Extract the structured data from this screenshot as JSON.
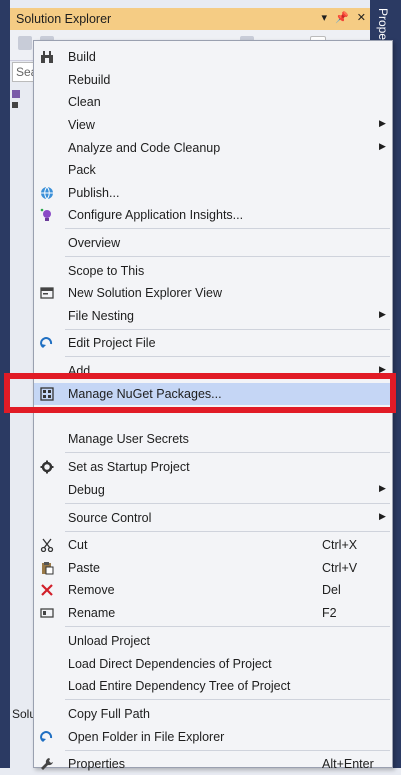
{
  "panel": {
    "title": "Solution Explorer",
    "title_buttons": [
      "▾",
      "📌",
      "✕"
    ],
    "right_tab": "Prope",
    "search_placeholder": "Sea",
    "bottom_tab": "Solu"
  },
  "menu": {
    "items": [
      {
        "label": "Build",
        "icon": "build-icon",
        "shortcut": "",
        "submenu": false
      },
      {
        "label": "Rebuild",
        "icon": "",
        "shortcut": "",
        "submenu": false
      },
      {
        "label": "Clean",
        "icon": "",
        "shortcut": "",
        "submenu": false
      },
      {
        "label": "View",
        "icon": "",
        "shortcut": "",
        "submenu": true
      },
      {
        "label": "Analyze and Code Cleanup",
        "icon": "",
        "shortcut": "",
        "submenu": true
      },
      {
        "label": "Pack",
        "icon": "",
        "shortcut": "",
        "submenu": false
      },
      {
        "label": "Publish...",
        "icon": "globe-icon",
        "shortcut": "",
        "submenu": false
      },
      {
        "label": "Configure Application Insights...",
        "icon": "insights-icon",
        "shortcut": "",
        "submenu": false
      },
      {
        "label": "Overview",
        "icon": "",
        "shortcut": "",
        "submenu": false
      },
      {
        "label": "Scope to This",
        "icon": "",
        "shortcut": "",
        "submenu": false
      },
      {
        "label": "New Solution Explorer View",
        "icon": "new-view-icon",
        "shortcut": "",
        "submenu": false
      },
      {
        "label": "File Nesting",
        "icon": "",
        "shortcut": "",
        "submenu": true
      },
      {
        "label": "Edit Project File",
        "icon": "edit-arrow-icon",
        "shortcut": "",
        "submenu": false
      },
      {
        "label": "Add",
        "icon": "",
        "shortcut": "",
        "submenu": true
      },
      {
        "label": "Manage NuGet Packages...",
        "icon": "nuget-icon",
        "shortcut": "",
        "submenu": false
      },
      {
        "label": "Manage User Secrets",
        "icon": "",
        "shortcut": "",
        "submenu": false
      },
      {
        "label": "Set as Startup Project",
        "icon": "gear-icon",
        "shortcut": "",
        "submenu": false
      },
      {
        "label": "Debug",
        "icon": "",
        "shortcut": "",
        "submenu": true
      },
      {
        "label": "Source Control",
        "icon": "",
        "shortcut": "",
        "submenu": true
      },
      {
        "label": "Cut",
        "icon": "scissors-icon",
        "shortcut": "Ctrl+X",
        "submenu": false
      },
      {
        "label": "Paste",
        "icon": "paste-icon",
        "shortcut": "Ctrl+V",
        "submenu": false
      },
      {
        "label": "Remove",
        "icon": "remove-x-icon",
        "shortcut": "Del",
        "submenu": false
      },
      {
        "label": "Rename",
        "icon": "rename-icon",
        "shortcut": "F2",
        "submenu": false
      },
      {
        "label": "Unload Project",
        "icon": "",
        "shortcut": "",
        "submenu": false
      },
      {
        "label": "Load Direct Dependencies of Project",
        "icon": "",
        "shortcut": "",
        "submenu": false
      },
      {
        "label": "Load Entire Dependency Tree of Project",
        "icon": "",
        "shortcut": "",
        "submenu": false
      },
      {
        "label": "Copy Full Path",
        "icon": "",
        "shortcut": "",
        "submenu": false
      },
      {
        "label": "Open Folder in File Explorer",
        "icon": "open-folder-icon",
        "shortcut": "",
        "submenu": false
      },
      {
        "label": "Properties",
        "icon": "wrench-icon",
        "shortcut": "Alt+Enter",
        "submenu": false
      }
    ],
    "highlighted_item": "Manage NuGet Packages..."
  },
  "colors": {
    "title_bar": "#f5cc84",
    "highlight": "#c5d6f5",
    "callout_border": "#e11b26"
  }
}
